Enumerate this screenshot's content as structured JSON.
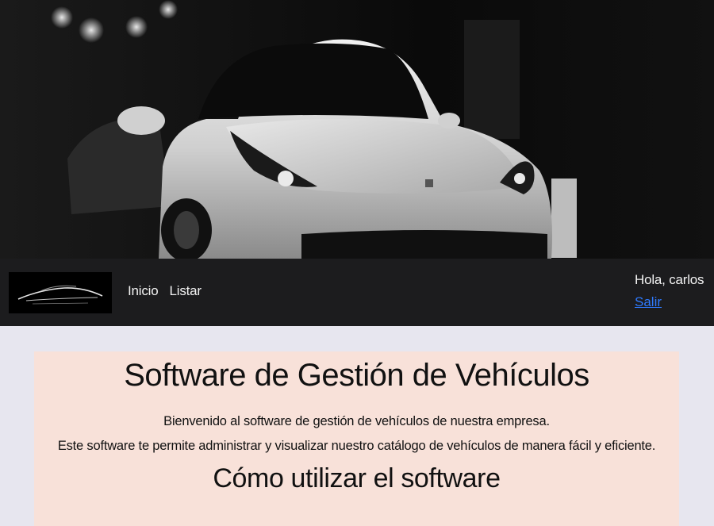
{
  "hero": {
    "image": "sports-car-banner",
    "colors": {
      "background": "#050505",
      "car": "#d9d9d9"
    }
  },
  "navbar": {
    "logo": "car-silhouette-logo",
    "links": [
      {
        "label": "Inicio"
      },
      {
        "label": "Listar"
      }
    ],
    "user": {
      "greeting": "Hola, carlos",
      "logout_label": "Salir"
    },
    "colors": {
      "background": "#1c1c1e",
      "text": "#f2f2f2",
      "link": "#2f7bff"
    }
  },
  "main": {
    "title": "Software de Gestión de Vehículos",
    "intro_line_1": "Bienvenido al software de gestión de vehículos de nuestra empresa.",
    "intro_line_2": "Este software te permite administrar y visualizar nuestro catálogo de vehículos de manera fácil y eficiente.",
    "section_title": "Cómo utilizar el software",
    "colors": {
      "page_background": "#e7e6ef",
      "card_background": "#f8e1d9"
    }
  }
}
